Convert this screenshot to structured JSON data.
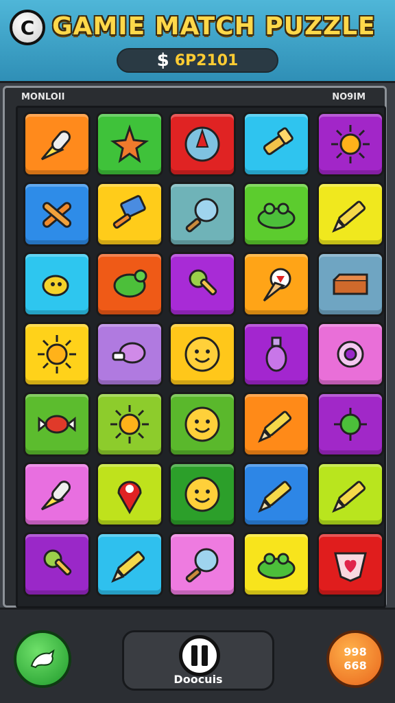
{
  "header": {
    "logo_letter": "C",
    "title": "GAMIE MATCH PUZZLE",
    "currency_symbol": "$",
    "score": "6P2101"
  },
  "board": {
    "left_label": "MONLOII",
    "right_label": "NO9IM",
    "tiles": [
      {
        "color": "#ff8a1c",
        "icon": "rocket-icon"
      },
      {
        "color": "#3fc23a",
        "icon": "star-fish-icon"
      },
      {
        "color": "#e02323",
        "icon": "compass-icon"
      },
      {
        "color": "#2fc4ef",
        "icon": "flashlight-icon"
      },
      {
        "color": "#a226c8",
        "icon": "sun-icon"
      },
      {
        "color": "#2e8ce8",
        "icon": "crossed-tools-icon"
      },
      {
        "color": "#ffcc1a",
        "icon": "hammer-icon"
      },
      {
        "color": "#6fb3b8",
        "icon": "magnifier-icon"
      },
      {
        "color": "#5ccc2e",
        "icon": "frog-icon"
      },
      {
        "color": "#f0e81e",
        "icon": "pencil-icon"
      },
      {
        "color": "#2ec6ef",
        "icon": "bird-icon"
      },
      {
        "color": "#ef5a17",
        "icon": "turtle-icon"
      },
      {
        "color": "#a82bd6",
        "icon": "key-icon"
      },
      {
        "color": "#ffa417",
        "icon": "ice-cream-icon"
      },
      {
        "color": "#6fa5c2",
        "icon": "box-icon"
      },
      {
        "color": "#ffd21a",
        "icon": "sun-icon"
      },
      {
        "color": "#b07ae0",
        "icon": "cup-icon"
      },
      {
        "color": "#ffc71a",
        "icon": "smiley-icon"
      },
      {
        "color": "#a326cf",
        "icon": "potion-icon"
      },
      {
        "color": "#e96fd8",
        "icon": "gear-icon"
      },
      {
        "color": "#5cbc2e",
        "icon": "candy-icon"
      },
      {
        "color": "#8dcc2c",
        "icon": "sun-icon"
      },
      {
        "color": "#5ab82c",
        "icon": "smiley-icon"
      },
      {
        "color": "#ff8a18",
        "icon": "pencil-icon"
      },
      {
        "color": "#a128c8",
        "icon": "virus-icon"
      },
      {
        "color": "#e86fe0",
        "icon": "rocket-icon"
      },
      {
        "color": "#bfe21c",
        "icon": "map-pin-icon"
      },
      {
        "color": "#2c9f2a",
        "icon": "smiley-icon"
      },
      {
        "color": "#2d86e6",
        "icon": "pencil-icon"
      },
      {
        "color": "#b9e51e",
        "icon": "pencil-icon"
      },
      {
        "color": "#9a28c8",
        "icon": "key-icon"
      },
      {
        "color": "#2fc0ee",
        "icon": "pencil-icon"
      },
      {
        "color": "#ee7be0",
        "icon": "magnifier-icon"
      },
      {
        "color": "#f8e41c",
        "icon": "frog-icon"
      },
      {
        "color": "#e01d1d",
        "icon": "heart-icon"
      }
    ]
  },
  "footer": {
    "center_label": "Doocuis",
    "right_line1": "998",
    "right_line2": "668"
  }
}
